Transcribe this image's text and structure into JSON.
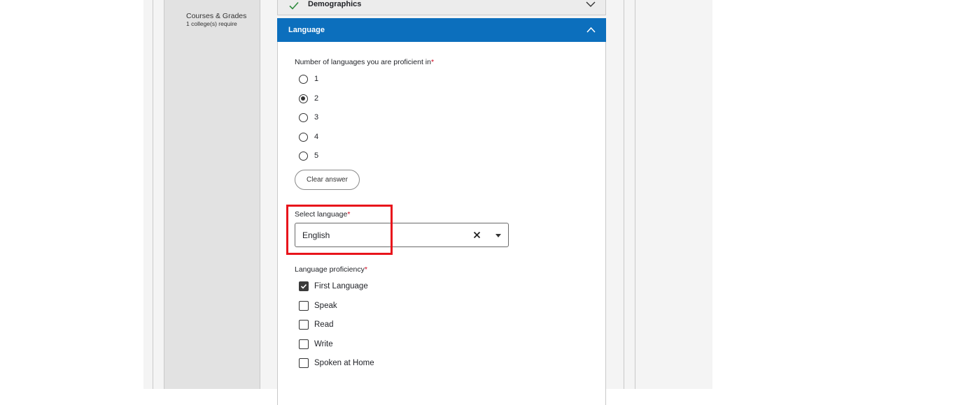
{
  "sidebar": {
    "item": {
      "title": "Courses & Grades",
      "subtitle": "1 college(s) require"
    }
  },
  "sections": {
    "demographics": {
      "label": "Demographics",
      "status_icon": "check-icon",
      "toggle_icon": "chevron-down-icon"
    },
    "language": {
      "label": "Language",
      "toggle_icon": "chevron-up-icon",
      "header_color": "#0c6fbd"
    }
  },
  "language_form": {
    "count_question": {
      "label": "Number of languages you are proficient in",
      "required_mark": "*"
    },
    "count_options": [
      "1",
      "2",
      "3",
      "4",
      "5"
    ],
    "count_selected": "2",
    "clear_label": "Clear answer",
    "select_language": {
      "label": "Select language",
      "required_mark": "*",
      "value": "English"
    },
    "proficiency_question": {
      "label": "Language proficiency",
      "required_mark": "*"
    },
    "proficiency_options": [
      {
        "label": "First Language",
        "checked": true
      },
      {
        "label": "Speak",
        "checked": false
      },
      {
        "label": "Read",
        "checked": false
      },
      {
        "label": "Write",
        "checked": false
      },
      {
        "label": "Spoken at Home",
        "checked": false
      }
    ]
  },
  "highlight_color": "#e8141b"
}
